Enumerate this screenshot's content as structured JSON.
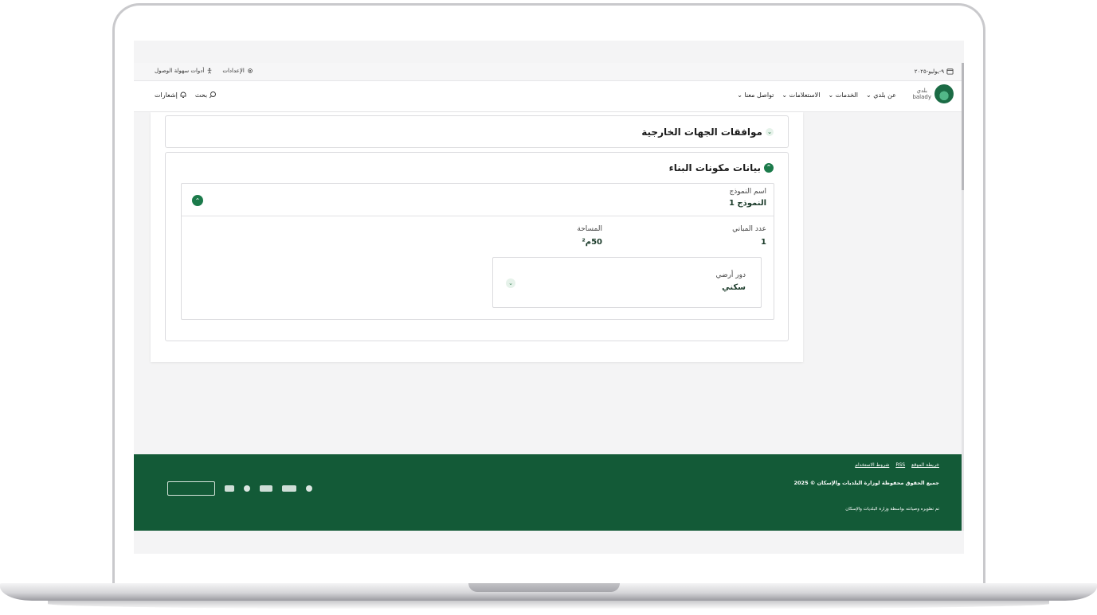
{
  "utility_bar": {
    "date": "٩-يوليو-٢٠٢٥",
    "settings_label": "الإعدادات",
    "accessibility_label": "أدوات سهولة الوصول"
  },
  "navbar": {
    "logo_text_ar": "بلدي",
    "logo_text_en": "balady",
    "menu": [
      "عن بلدي",
      "الخدمات",
      "الاستعلامات",
      "تواصل معنا"
    ],
    "search_label": "بحث",
    "notifications_label": "إشعارات"
  },
  "content": {
    "external_approvals_title": "موافقات الجهات الخارجية",
    "building_components_title": "بيانات مكونات البناء",
    "model": {
      "name_label": "اسم النموذج",
      "name_value": "النموذج 1",
      "buildings_count_label": "عدد المباني",
      "buildings_count_value": "1",
      "area_label": "المساحة",
      "area_value": "50م²"
    },
    "floor": {
      "floor_label": "دور أرضي",
      "floor_value": "سكني"
    }
  },
  "footer": {
    "links": [
      "خريطة الموقع",
      "RSS",
      "شروط الاستخدام"
    ],
    "copyright": "جميع الحقوق محفوظة لوزارة البلديات والإسكان © 2025",
    "developed_by": "تم تطويره وصيانته بواسطة وزارة البلديات والإسكان"
  },
  "colors": {
    "brand_green": "#135a37",
    "accent_green": "#1b7a4a"
  }
}
